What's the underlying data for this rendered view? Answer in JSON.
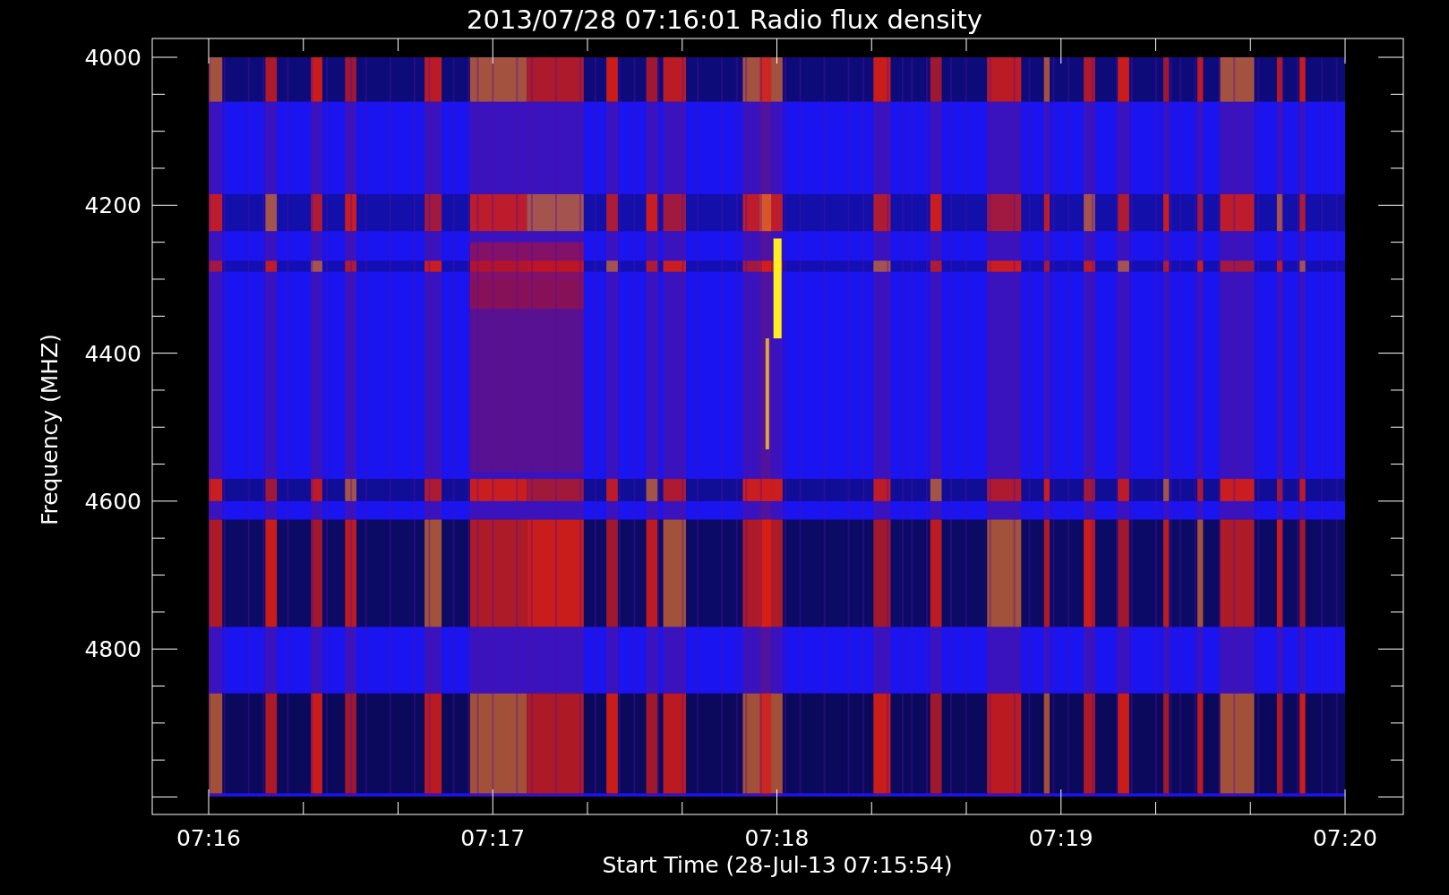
{
  "title": "2013/07/28 07:16:01 Radio flux density",
  "y_axis": {
    "label": "Frequency (MHZ)",
    "ticks": [
      "4000",
      "4200",
      "4400",
      "4600",
      "4800"
    ]
  },
  "x_axis": {
    "label": "Start Time (28-Jul-13 07:15:54)",
    "ticks": [
      "07:16",
      "07:17",
      "07:18",
      "07:19",
      "07:20"
    ]
  }
}
